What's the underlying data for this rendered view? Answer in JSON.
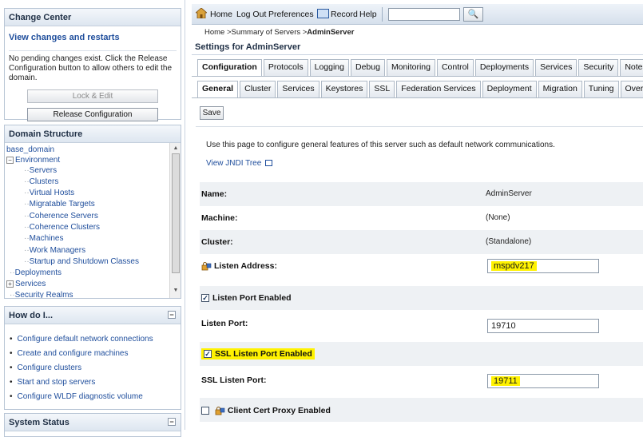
{
  "change_center": {
    "title": "Change Center",
    "link": "View changes and restarts",
    "message": "No pending changes exist. Click the Release Configuration button to allow others to edit the domain.",
    "lock_edit_label": "Lock & Edit",
    "release_label": "Release Configuration"
  },
  "domain_structure": {
    "title": "Domain Structure",
    "items": [
      "base_domain",
      "Environment",
      "Servers",
      "Clusters",
      "Virtual Hosts",
      "Migratable Targets",
      "Coherence Servers",
      "Coherence Clusters",
      "Machines",
      "Work Managers",
      "Startup and Shutdown Classes",
      "Deployments",
      "Services",
      "Security Realms"
    ]
  },
  "how_do_i": {
    "title": "How do I...",
    "items": [
      "Configure default network connections",
      "Create and configure machines",
      "Configure clusters",
      "Start and stop servers",
      "Configure WLDF diagnostic volume"
    ]
  },
  "system_status": {
    "title": "System Status"
  },
  "toolbar": {
    "home": "Home",
    "logout": "Log Out",
    "preferences": "Preferences",
    "record": "Record",
    "help": "Help",
    "search_value": "",
    "go_glyph": "🔍"
  },
  "breadcrumb": {
    "prefix": "Home >Summary of Servers >",
    "current": "AdminServer"
  },
  "settings_title": "Settings for AdminServer",
  "tabs_primary": [
    "Configuration",
    "Protocols",
    "Logging",
    "Debug",
    "Monitoring",
    "Control",
    "Deployments",
    "Services",
    "Security",
    "Notes"
  ],
  "tabs_secondary": [
    "General",
    "Cluster",
    "Services",
    "Keystores",
    "SSL",
    "Federation Services",
    "Deployment",
    "Migration",
    "Tuning",
    "Overlo"
  ],
  "save_label": "Save",
  "description": "Use this page to configure general features of this server such as default network communications.",
  "jndi_link": "View JNDI Tree",
  "fields": {
    "name_label": "Name:",
    "name_value": "AdminServer",
    "machine_label": "Machine:",
    "machine_value": "(None)",
    "cluster_label": "Cluster:",
    "cluster_value": "(Standalone)",
    "listen_address_label": "Listen Address:",
    "listen_address_value": "mspdv217",
    "listen_port_enabled_label": "Listen Port Enabled",
    "listen_port_label": "Listen Port:",
    "listen_port_value": "19710",
    "ssl_enabled_label": "SSL Listen Port Enabled",
    "ssl_port_label": "SSL Listen Port:",
    "ssl_port_value": "19711",
    "client_cert_label": "Client Cert Proxy Enabled"
  },
  "colors": {
    "highlight": "#fff200",
    "link": "#1f4e9c",
    "header_bg": "#dde6f0"
  }
}
